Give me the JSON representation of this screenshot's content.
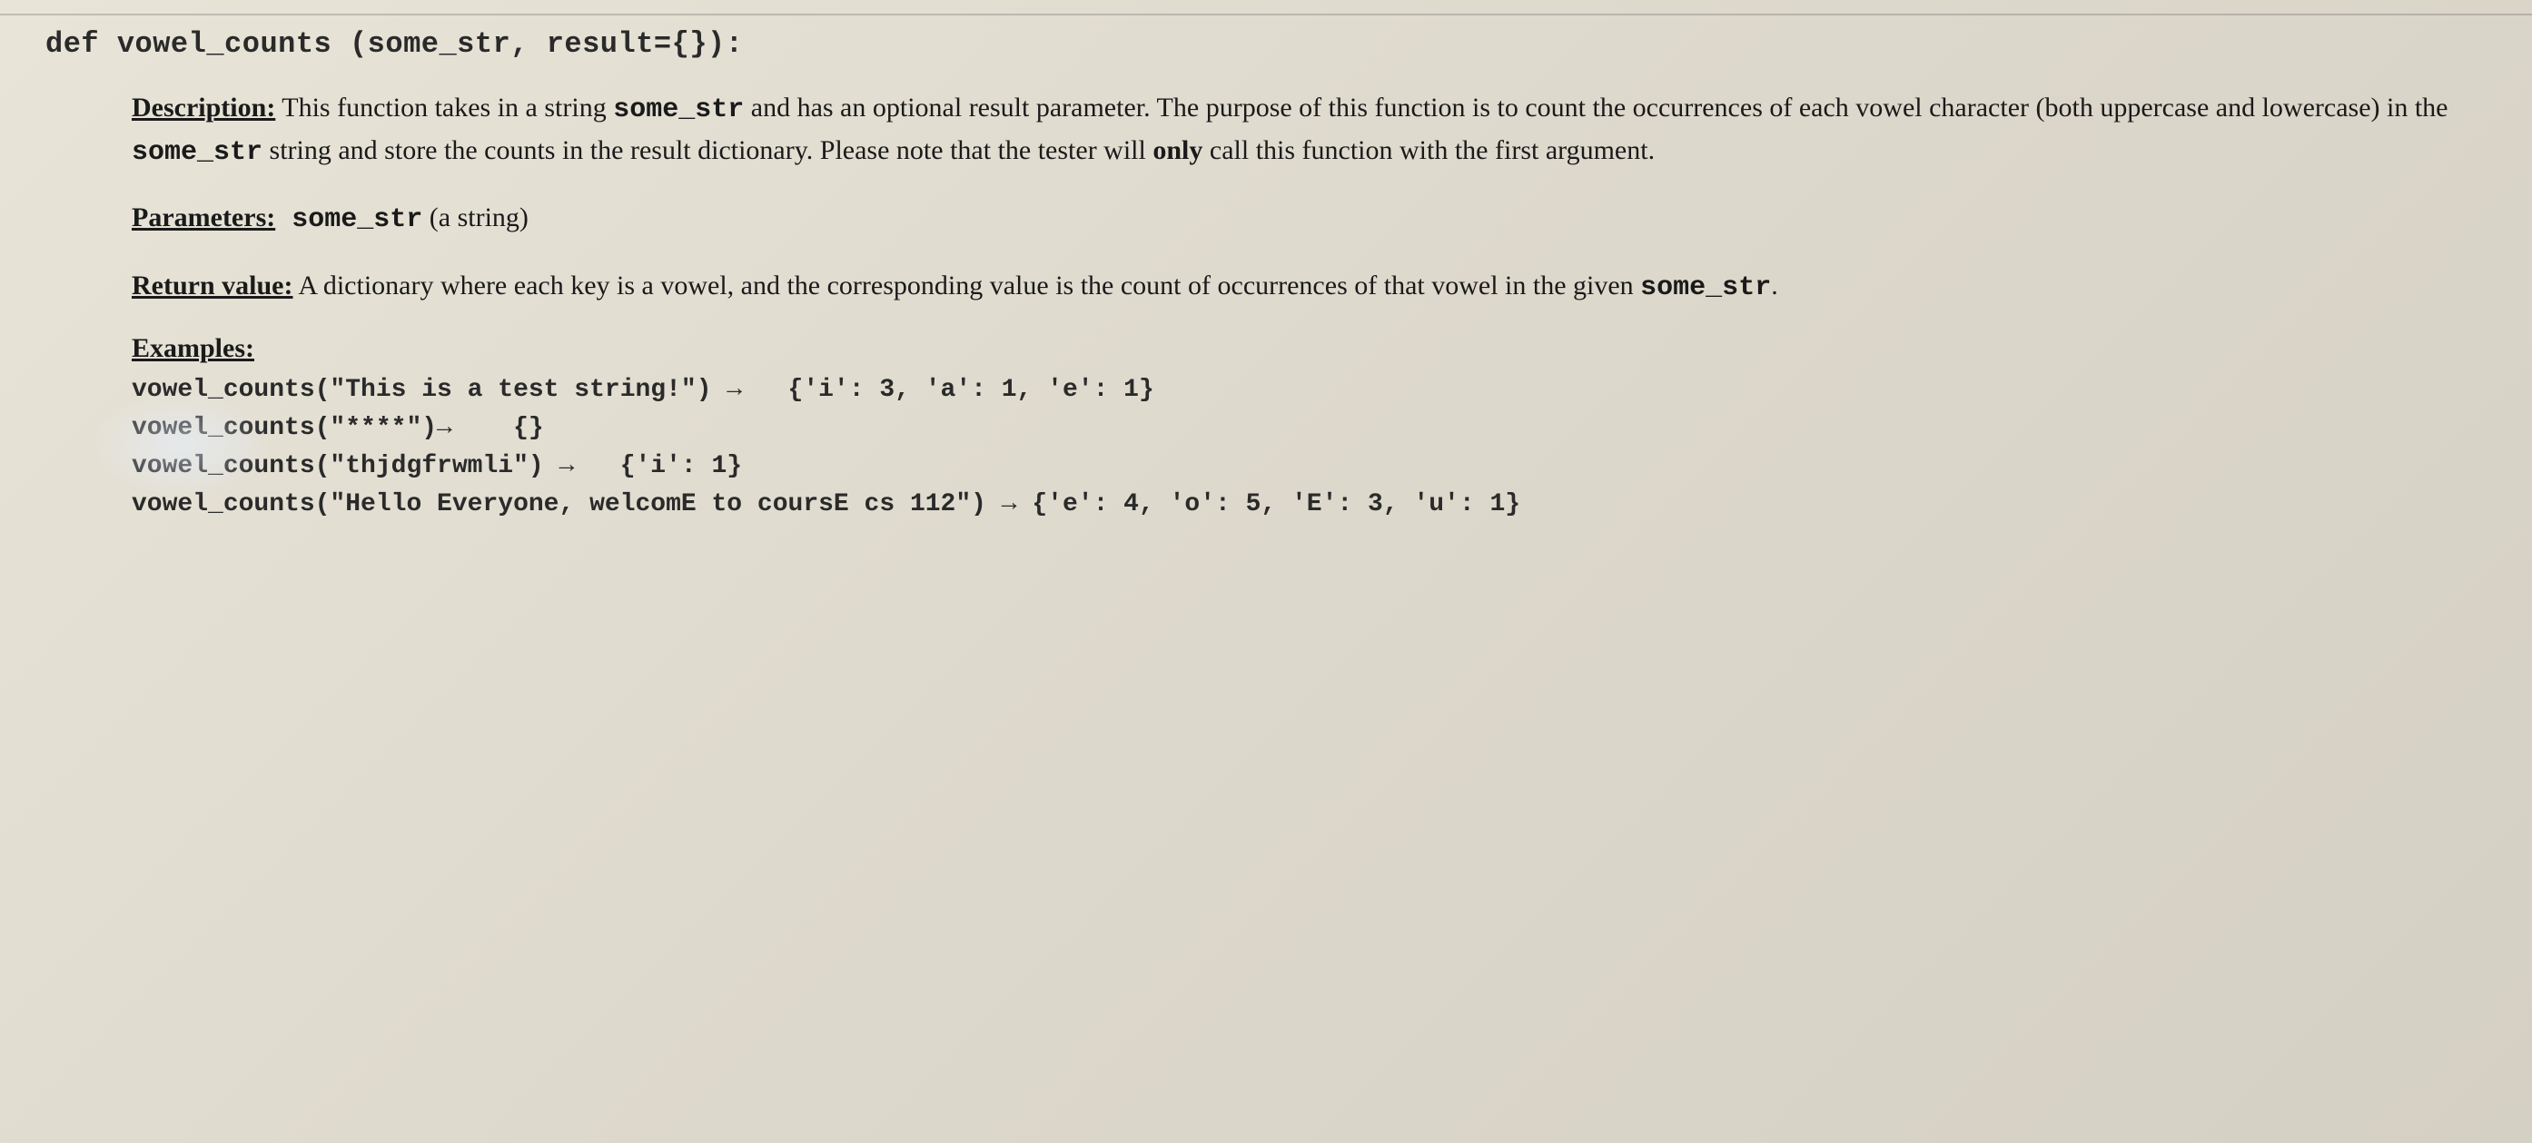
{
  "signature": "def vowel_counts (some_str, result={}):",
  "description": {
    "label": "Description:",
    "text_part1": " This function takes in a string ",
    "code1": "some_str",
    "text_part2": "  and has an optional result parameter.  The purpose of this function is to count the occurrences of each vowel character (both uppercase and lowercase) in the ",
    "code2": "some_str",
    "text_part3": " string and store the counts in the result dictionary. Please note that the tester will ",
    "bold_word": "only",
    "text_part4": " call this function with the first argument."
  },
  "parameters": {
    "label": "Parameters:",
    "code": " some_str",
    "text": " (a string)"
  },
  "return_value": {
    "label": "Return value:",
    "text_part1": " A dictionary where each key is a vowel, and the corresponding value is the count of occurrences of that vowel in the given ",
    "code": "some_str",
    "text_part2": "."
  },
  "examples": {
    "label": "Examples:",
    "lines": [
      "vowel_counts(\"This is a test string!\") →   {'i': 3, 'a': 1, 'e': 1}",
      "vowel_counts(\"****\")→    {}",
      "vowel_counts(\"thjdgfrwmli\") →   {'i': 1}",
      "vowel_counts(\"Hello Everyone, welcomE to coursE cs 112\") → {'e': 4, 'o': 5, 'E': 3, 'u': 1}"
    ]
  }
}
